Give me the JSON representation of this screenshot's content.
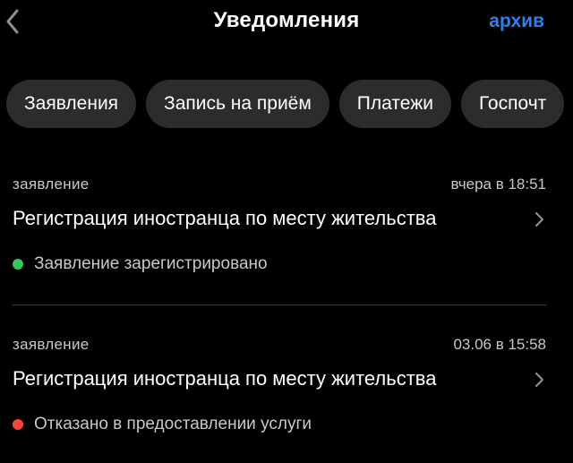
{
  "header": {
    "title": "Уведомления",
    "archive_label": "архив",
    "back_icon": "chevron-left-icon"
  },
  "filters": [
    {
      "label": "Заявления"
    },
    {
      "label": "Запись на приём"
    },
    {
      "label": "Платежи"
    },
    {
      "label": "Госпочт"
    }
  ],
  "notifications": [
    {
      "type": "заявление",
      "time": "вчера в 18:51",
      "title": "Регистрация иностранца по месту жительства",
      "status": "Заявление зарегистрировано",
      "status_color": "#34c759"
    },
    {
      "type": "заявление",
      "time": "03.06 в 15:58",
      "title": "Регистрация иностранца по месту жительства",
      "status": "Отказано в предоставлении услуги",
      "status_color": "#ff453a"
    }
  ],
  "colors": {
    "background": "#000000",
    "accent": "#2f80ed",
    "chip_bg": "#2c2c2f",
    "secondary_text": "#c7c7cc"
  }
}
